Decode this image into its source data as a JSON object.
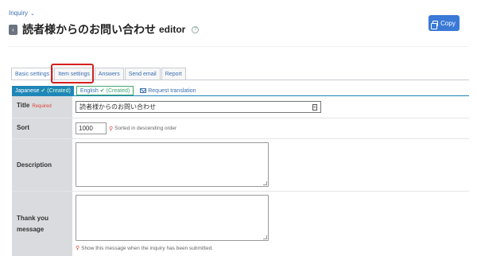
{
  "breadcrumb": {
    "label": "Inquiry"
  },
  "header": {
    "title": "読者様からのお問い合わせ",
    "suffix": "editor",
    "copy_label": "Copy"
  },
  "tabs": [
    {
      "label": "Basic settings",
      "active": true
    },
    {
      "label": "Item settings",
      "active": false
    },
    {
      "label": "Answers",
      "active": false
    },
    {
      "label": "Send email",
      "active": false
    },
    {
      "label": "Report",
      "active": false
    }
  ],
  "languages": {
    "active": {
      "name": "Japanese",
      "status": "(Created)"
    },
    "other": {
      "name": "English",
      "status": "(Created)"
    },
    "request_label": "Request translation"
  },
  "form": {
    "title": {
      "label": "Title",
      "required": "Required",
      "value": "読者様からのお問い合わせ"
    },
    "sort": {
      "label": "Sort",
      "value": "1000",
      "hint": "Sorted in descending order"
    },
    "description": {
      "label": "Description"
    },
    "thankyou": {
      "label": "Thank you message",
      "hint": "Show this message when the inquiry has been submitted."
    }
  },
  "colors": {
    "accent": "#3b79d6",
    "highlight": "#d42020",
    "lang_active": "#1f86b8"
  }
}
